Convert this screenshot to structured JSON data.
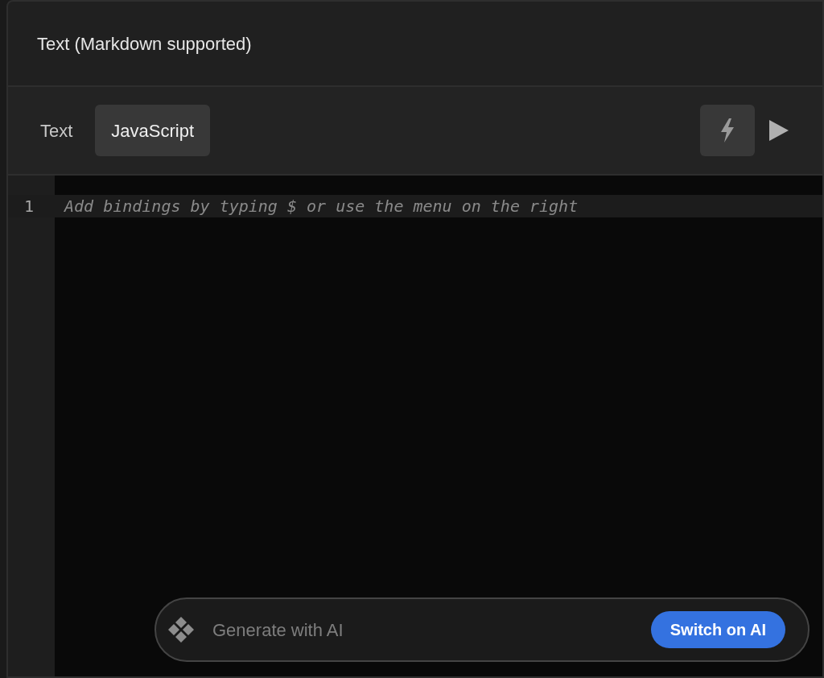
{
  "panel": {
    "title": "Text (Markdown supported)"
  },
  "tabs": [
    {
      "label": "Text",
      "selected": false
    },
    {
      "label": "JavaScript",
      "selected": true
    }
  ],
  "toolbar": {
    "bolt_active": true
  },
  "editor": {
    "line_numbers": [
      "1"
    ],
    "placeholder": "Add bindings by typing $ or use the menu on the right"
  },
  "ai_bar": {
    "placeholder": "Generate with AI",
    "button": "Switch on AI"
  }
}
